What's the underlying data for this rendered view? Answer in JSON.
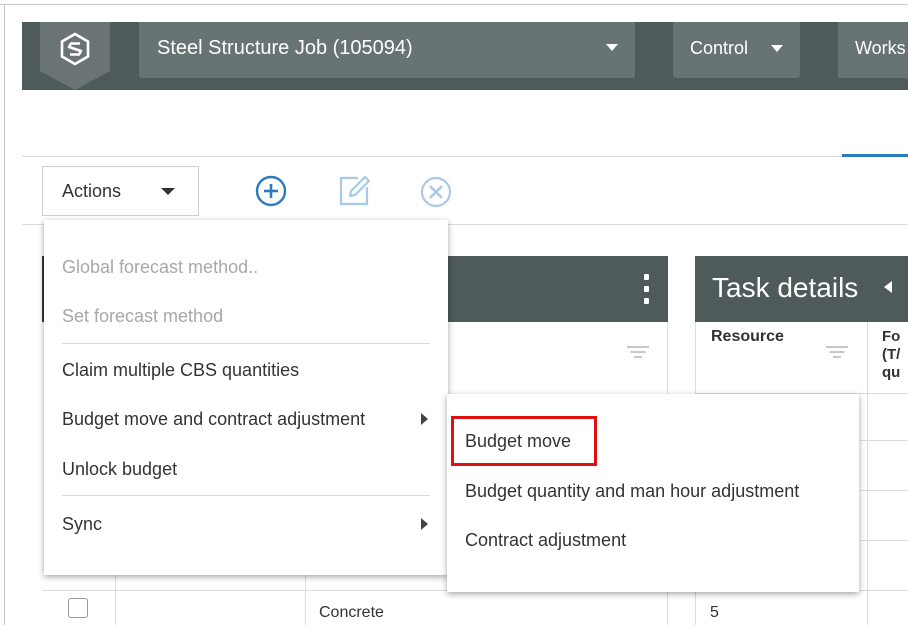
{
  "header": {
    "job_title": "Steel Structure Job (105094)",
    "control_label": "Control",
    "works_label": "Works",
    "bar_color": "#4f5a5a"
  },
  "toolbar": {
    "actions_label": "Actions",
    "icons": [
      "add-circle-icon",
      "edit-icon",
      "cancel-circle-icon"
    ],
    "accent_color": "#2c7bbf"
  },
  "task_panel": {
    "title": "Task details",
    "resource_label": "Resource",
    "fo_label_lines": [
      "Fo",
      "(T/",
      "qu"
    ]
  },
  "grid": {
    "visible_row": {
      "description": "Concrete",
      "value": "5"
    }
  },
  "actions_menu": {
    "items": [
      {
        "label": "Global forecast method..",
        "enabled": false
      },
      {
        "label": "Set forecast method",
        "enabled": false
      },
      {
        "label": "Claim multiple CBS quantities",
        "enabled": true
      },
      {
        "label": "Budget move and contract adjustment",
        "enabled": true,
        "has_submenu": true
      },
      {
        "label": "Unlock budget",
        "enabled": true
      },
      {
        "label": "Sync",
        "enabled": true,
        "has_submenu": true
      }
    ]
  },
  "sub_menu": {
    "items": [
      {
        "label": "Budget move",
        "highlighted": true
      },
      {
        "label": "Budget quantity and man hour adjustment"
      },
      {
        "label": "Contract adjustment"
      }
    ],
    "highlight_color": "#e01010"
  }
}
